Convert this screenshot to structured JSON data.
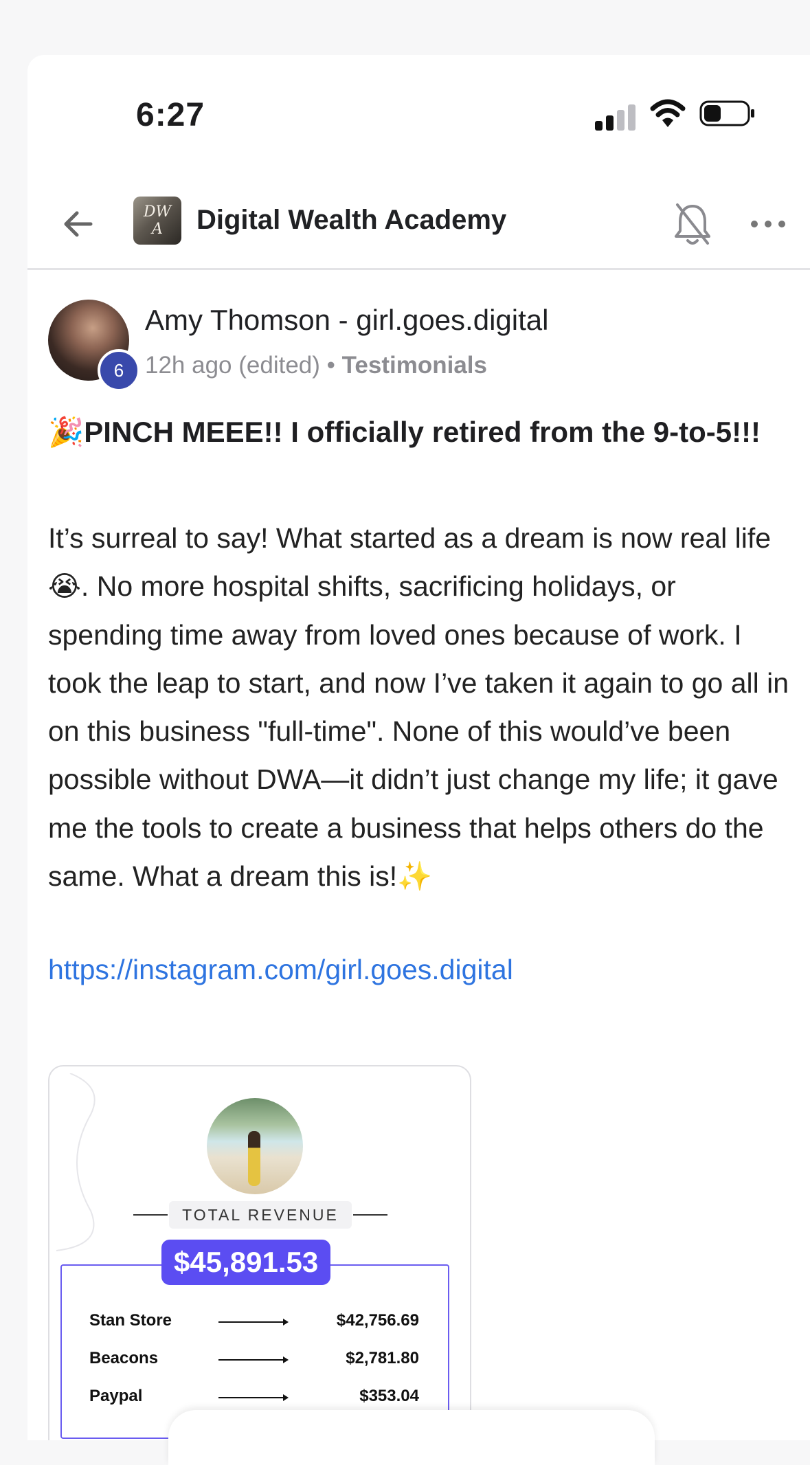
{
  "status_bar": {
    "time": "6:27"
  },
  "header": {
    "group_name": "Digital Wealth Academy",
    "logo_text": "DW A"
  },
  "post": {
    "author": "Amy Thomson - girl.goes.digital",
    "level_badge": "6",
    "time": "12h ago (edited)",
    "separator": " • ",
    "category": "Testimonials",
    "title_emoji": "🎉",
    "title": "PINCH MEEE!! I officially retired from the 9-to-5!!!",
    "body_part1": "It’s surreal to say! What started as a dream is now real life ",
    "body_emoji": "😭",
    "body_part2": ". No more hospital shifts, sacrificing holidays, or spending time away from loved ones because of work. I took the leap to start, and now I’ve taken it again to go all in on this business \"full-time\". None of this would’ve been possible without DWA—it didn’t just change my life; it gave me the tools to create a business that helps others do the same. What a dream this is!",
    "body_end_emoji": "✨",
    "link": "https://instagram.com/girl.goes.digital"
  },
  "revenue_card": {
    "label": "TOTAL REVENUE",
    "total": "$45,891.53",
    "rows": [
      {
        "source": "Stan Store",
        "amount": "$42,756.69"
      },
      {
        "source": "Beacons",
        "amount": "$2,781.80"
      },
      {
        "source": "Paypal",
        "amount": "$353.04"
      }
    ]
  },
  "colors": {
    "accent": "#5b4df2",
    "link": "#2e74e0",
    "badge": "#3949ab"
  }
}
